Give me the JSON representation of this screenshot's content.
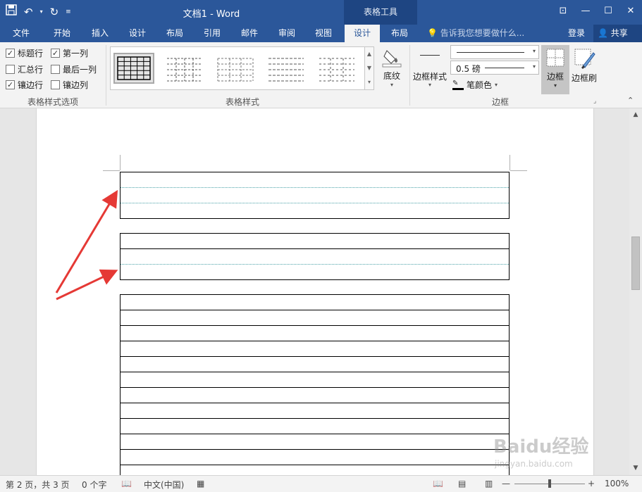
{
  "app": {
    "title": "文档1 - Word",
    "context_tab_title": "表格工具",
    "qat": {
      "save_icon": "save-icon",
      "undo_icon": "undo-icon",
      "redo_icon": "redo-icon",
      "customize_icon": "customize-icon"
    },
    "window_controls": [
      "ribbon-display-icon",
      "minimize-icon",
      "maximize-icon",
      "close-icon"
    ]
  },
  "tabs": [
    {
      "label": "文件"
    },
    {
      "label": "开始"
    },
    {
      "label": "插入"
    },
    {
      "label": "设计"
    },
    {
      "label": "布局"
    },
    {
      "label": "引用"
    },
    {
      "label": "邮件"
    },
    {
      "label": "审阅"
    },
    {
      "label": "视图"
    },
    {
      "label": "设计",
      "active": true
    },
    {
      "label": "布局"
    }
  ],
  "tell_me": "告诉我您想要做什么...",
  "login": "登录",
  "share": "共享",
  "ribbon": {
    "style_options": {
      "label": "表格样式选项",
      "checkboxes": [
        {
          "label": "标题行",
          "checked": true
        },
        {
          "label": "第一列",
          "checked": true
        },
        {
          "label": "汇总行",
          "checked": false
        },
        {
          "label": "最后一列",
          "checked": false
        },
        {
          "label": "镶边行",
          "checked": true
        },
        {
          "label": "镶边列",
          "checked": false
        }
      ]
    },
    "table_styles": {
      "label": "表格样式"
    },
    "shading": {
      "label": "底纹"
    },
    "borders": {
      "label": "边框",
      "border_styles_label": "边框样式",
      "pen_weight": "0.5 磅",
      "pen_color_label": "笔颜色",
      "borders_button": "边框",
      "border_painter": "边框刷"
    },
    "accent_color": "#2b579a"
  },
  "status": {
    "page": "第 2 页，共 3 页",
    "words": "0 个字",
    "language": "中文(中国)",
    "zoom": "100%"
  },
  "watermark": {
    "brand": "Baidu经验",
    "url": "jingyan.baidu.com"
  },
  "document": {
    "tables": [
      {
        "rows": 3,
        "inner_border": "dotted"
      },
      {
        "rows": 3,
        "inner_border": "solid-first-then-dotted"
      },
      {
        "rows": 12,
        "inner_border": "solid"
      }
    ],
    "annotation_color": "#e53935"
  }
}
